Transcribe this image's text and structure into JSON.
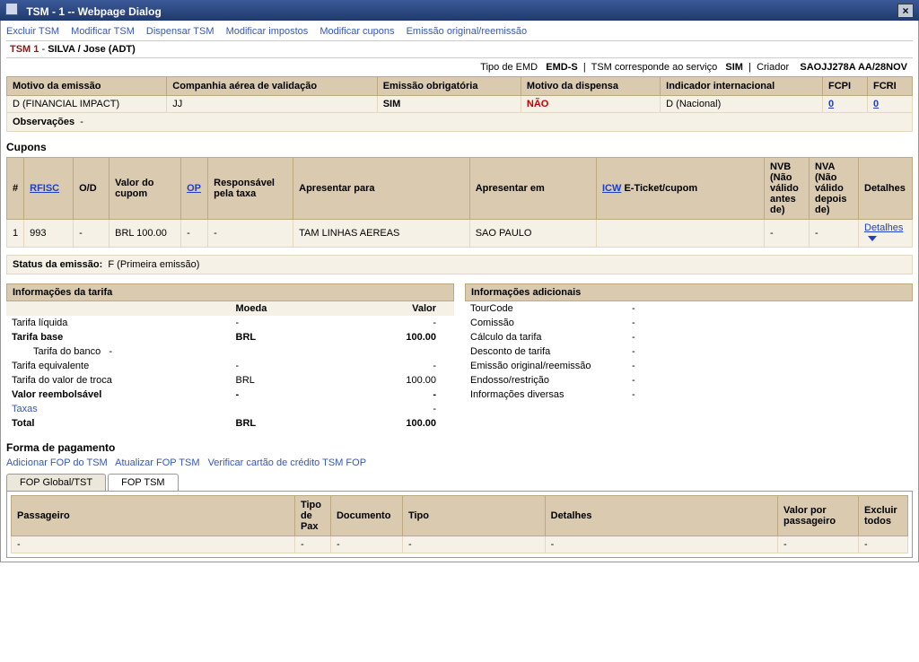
{
  "window": {
    "title": "TSM - 1 -- Webpage Dialog"
  },
  "actions": {
    "excluir": "Excluir TSM",
    "modificar": "Modificar TSM",
    "dispensar": "Dispensar TSM",
    "mod_impostos": "Modificar impostos",
    "mod_cupons": "Modificar cupons",
    "emissao_orig": "Emissão original/reemissão"
  },
  "passenger": {
    "tsm_label": "TSM 1",
    "sep": " - ",
    "name": "SILVA / Jose (ADT)"
  },
  "meta": {
    "tipo_emd_label": "Tipo de EMD",
    "tipo_emd_value": "EMD-S",
    "corresponde_label": "TSM corresponde ao serviço",
    "corresponde_value": "SIM",
    "criador_label": "Criador",
    "criador_value": "SAOJJ278A AA/28NOV"
  },
  "info_grid": {
    "headers": {
      "motivo": "Motivo da emissão",
      "companhia": "Companhia aérea de validação",
      "emissao_obr": "Emissão obrigatória",
      "motivo_disp": "Motivo da dispensa",
      "indicador": "Indicador internacional",
      "fcpi": "FCPI",
      "fcri": "FCRI"
    },
    "row": {
      "motivo": "D (FINANCIAL IMPACT)",
      "companhia": "JJ",
      "emissao_obr": "SIM",
      "motivo_disp": "NÃO",
      "indicador": "D (Nacional)",
      "fcpi": "0",
      "fcri": "0"
    },
    "obs_label": "Observações",
    "obs_value": "-"
  },
  "cupons": {
    "title": "Cupons",
    "headers": {
      "num": "#",
      "rfisc": "RFISC",
      "od": "O/D",
      "valor": "Valor do cupom",
      "op": "OP",
      "resp": "Responsável pela taxa",
      "apresentar_para": "Apresentar para",
      "apresentar_em": "Apresentar em",
      "icw": "ICW",
      "eticket": " E-Ticket/cupom",
      "nvb": "NVB (Não válido antes de)",
      "nva": "NVA (Não válido depois de)",
      "detalhes": "Detalhes"
    },
    "row": {
      "num": "1",
      "rfisc": "993",
      "od": "-",
      "valor": "BRL 100.00",
      "op": "-",
      "resp": "-",
      "apresentar_para": "TAM LINHAS AEREAS",
      "apresentar_em": "SAO PAULO",
      "icw": "",
      "eticket": "",
      "nvb": "-",
      "nva": "-",
      "detalhes": "Detalhes"
    }
  },
  "status": {
    "label": "Status da emissão:",
    "value": "F (Primeira emissão)"
  },
  "tarifa": {
    "title": "Informações da tarifa",
    "headers": {
      "blank": "",
      "moeda": "Moeda",
      "valor": "Valor"
    },
    "rows": {
      "liquida": {
        "lbl": "Tarifa líquida",
        "moeda": "-",
        "valor": "-"
      },
      "base": {
        "lbl": "Tarifa base",
        "moeda": "BRL",
        "valor": "100.00"
      },
      "banco": {
        "lbl": "Tarifa do banco",
        "moeda": "-",
        "valor": ""
      },
      "equiv": {
        "lbl": "Tarifa equivalente",
        "moeda": "-",
        "valor": "-"
      },
      "troca": {
        "lbl": "Tarifa do valor de troca",
        "moeda": "BRL",
        "valor": "100.00"
      },
      "reemb": {
        "lbl": "Valor reembolsável",
        "moeda": "-",
        "valor": "-"
      },
      "taxas": {
        "lbl": "Taxas",
        "moeda": "",
        "valor": "-"
      },
      "total": {
        "lbl": "Total",
        "moeda": "BRL",
        "valor": "100.00"
      }
    }
  },
  "adicionais": {
    "title": "Informações adicionais",
    "rows": {
      "tourcode": {
        "lbl": "TourCode",
        "val": "-"
      },
      "comissao": {
        "lbl": "Comissão",
        "val": "-"
      },
      "calculo": {
        "lbl": "Cálculo da tarifa",
        "val": "-"
      },
      "desconto": {
        "lbl": "Desconto de tarifa",
        "val": "-"
      },
      "emissao": {
        "lbl": "Emissão original/reemissão",
        "val": "-"
      },
      "endosso": {
        "lbl": "Endosso/restrição",
        "val": "-"
      },
      "diversas": {
        "lbl": "Informações diversas",
        "val": "-"
      }
    }
  },
  "fop": {
    "title": "Forma de pagamento",
    "links": {
      "add": "Adicionar FOP do TSM",
      "update": "Atualizar FOP TSM",
      "verify": "Verificar cartão de crédito TSM FOP"
    },
    "tabs": {
      "global": "FOP Global/TST",
      "tsm": "FOP TSM"
    },
    "headers": {
      "passageiro": "Passageiro",
      "tipo_pax": "Tipo de Pax",
      "documento": "Documento",
      "tipo": "Tipo",
      "detalhes": "Detalhes",
      "valor_por": "Valor por passageiro",
      "excluir": "Excluir todos"
    },
    "row": {
      "passageiro": "-",
      "tipo_pax": "-",
      "documento": "-",
      "tipo": "-",
      "detalhes": "-",
      "valor_por": "-",
      "excluir": "-"
    }
  }
}
